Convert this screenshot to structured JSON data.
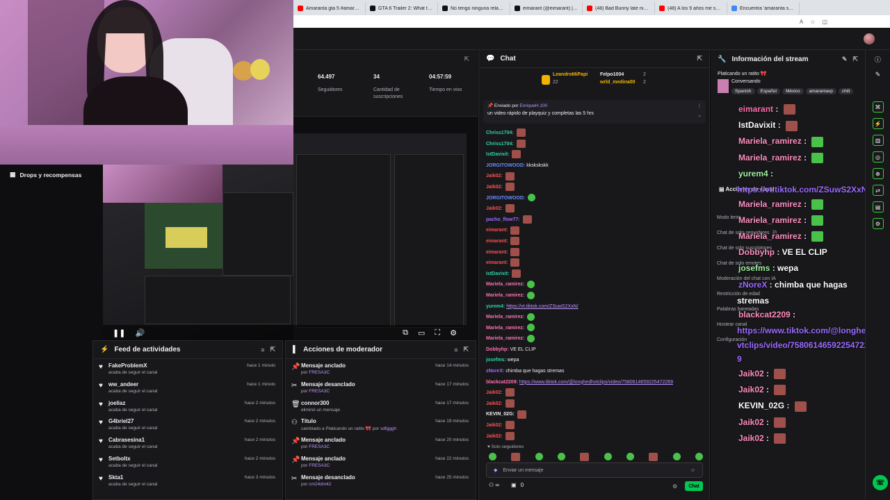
{
  "browser": {
    "tabs": [
      {
        "title": "Amaranta gta 5 #amaranta #",
        "color": "#ff0000"
      },
      {
        "title": "GTA 6 Trailer 2: What to Exp",
        "color": "#111111"
      },
      {
        "title": "No tengo ninguna relación e",
        "color": "#111111"
      },
      {
        "title": "eimarant (@eimarant) | TikTo",
        "color": "#111111"
      },
      {
        "title": "(48) Bad Bunny late night ce",
        "color": "#ff0000"
      },
      {
        "title": "(48) A los 9 años me secuest",
        "color": "#ff0000"
      },
      {
        "title": "Encuentra 'amaranta stream",
        "color": "#4285f4"
      }
    ]
  },
  "left_sidebar": {
    "drops_label": "Drops y recompensas"
  },
  "stats": {
    "followers_value": "64.497",
    "followers_label": "Seguidores",
    "subs_value": "34",
    "subs_label": "Cantidad de suscripciones",
    "live_value": "04:57:59",
    "live_label": "Tiempo en vivo"
  },
  "feed": {
    "title": "Feed de actividades",
    "items": [
      {
        "name": "FakeProblemX",
        "sub": "acaba de seguir el canal",
        "time": "hace 1 minuto"
      },
      {
        "name": "ww_andeer",
        "sub": "acaba de seguir el canal",
        "time": "hace 1 minuto"
      },
      {
        "name": "joeliaz",
        "sub": "acaba de seguir el canal",
        "time": "hace 2 minutos"
      },
      {
        "name": "G4briel27",
        "sub": "acaba de seguir el canal",
        "time": "hace 2 minutos"
      },
      {
        "name": "Cabrasesina1",
        "sub": "acaba de seguir el canal",
        "time": "hace 2 minutos"
      },
      {
        "name": "Setboltx",
        "sub": "acaba de seguir el canal",
        "time": "hace 2 minutos"
      },
      {
        "name": "Skta1",
        "sub": "acaba de seguir el canal",
        "time": "hace 3 minutos"
      }
    ]
  },
  "mod": {
    "title": "Acciones de moderador",
    "items": [
      {
        "icon": "pin",
        "name": "Mensaje anclado",
        "by": "por",
        "user": "FRESA3C",
        "time": "hace 14 minutos"
      },
      {
        "icon": "unpin",
        "name": "Mensaje desanclado",
        "by": "por",
        "user": "FRESA3C",
        "time": "hace 17 minutos"
      },
      {
        "icon": "trash",
        "name": "connor300",
        "by": "eliminó un mensaje",
        "user": "",
        "time": "hace 17 minutos"
      },
      {
        "icon": "title",
        "name": "Título",
        "by": "cambiado a Platicando un ratito 🎀 por",
        "user": "sdfgggh",
        "time": "hace 19 minutos"
      },
      {
        "icon": "pin",
        "name": "Mensaje anclado",
        "by": "por",
        "user": "FRESA3C",
        "time": "hace 20 minutos"
      },
      {
        "icon": "pin",
        "name": "Mensaje anclado",
        "by": "por",
        "user": "FRESA3C",
        "time": "hace 22 minutos"
      },
      {
        "icon": "unpin",
        "name": "Mensaje desanclado",
        "by": "por",
        "user": "cm24dm42",
        "time": "hace 25 minutos"
      }
    ]
  },
  "chat": {
    "title": "Chat",
    "leaders": [
      {
        "name": "LeandroMiPapi",
        "count": "22"
      },
      {
        "name": "Felpo1004",
        "count": "2"
      },
      {
        "name": "wrld_medina00",
        "count": "2"
      }
    ],
    "pinned_by_label": "Enviado por",
    "pinned_by_user": "EnriqueH.100",
    "pinned_text": "un video rápido de playquiz y completas las 5 hrs",
    "messages": [
      {
        "user": "Chriss1704:",
        "color": "#2dd3a8",
        "text": "",
        "emote": "r"
      },
      {
        "user": "Chriss1704:",
        "color": "#2dd3a8",
        "text": "",
        "emote": "r"
      },
      {
        "user": "IstDavixit:",
        "color": "#2dd3a8",
        "text": "",
        "emote": "r"
      },
      {
        "user": "JORGITOWOOD:",
        "color": "#6a8cff",
        "text": "kkskskskk",
        "emote": ""
      },
      {
        "user": "Jaik02:",
        "color": "#ff4f4f",
        "text": "",
        "emote": "r"
      },
      {
        "user": "Jaik02:",
        "color": "#ff4f4f",
        "text": "",
        "emote": "r"
      },
      {
        "user": "JORGITOWOOD:",
        "color": "#6a8cff",
        "text": "",
        "emote": "g"
      },
      {
        "user": "Jaik02:",
        "color": "#ff4f4f",
        "text": "",
        "emote": "r"
      },
      {
        "user": "pacho_flow77:",
        "color": "#9b6bff",
        "text": "",
        "emote": "r"
      },
      {
        "user": "eimarant:",
        "color": "#ff4f4f",
        "text": "",
        "emote": "r"
      },
      {
        "user": "eimarant:",
        "color": "#ff4f4f",
        "text": "",
        "emote": "r"
      },
      {
        "user": "eimarant:",
        "color": "#ff4f4f",
        "text": "",
        "emote": "r"
      },
      {
        "user": "eimarant:",
        "color": "#ff4f4f",
        "text": "",
        "emote": "r"
      },
      {
        "user": "IstDavixit:",
        "color": "#2dd3a8",
        "text": "",
        "emote": "r"
      },
      {
        "user": "Mariela_ramirez:",
        "color": "#ff6fb0",
        "text": "",
        "emote": "g"
      },
      {
        "user": "Mariela_ramirez:",
        "color": "#ff6fb0",
        "text": "",
        "emote": "g"
      },
      {
        "user": "yurem4:",
        "color": "#2dd3a8",
        "text": "",
        "link": "https://vt.tiktok.com/ZSuwS2XxN/",
        "emote": ""
      },
      {
        "user": "Mariela_ramirez:",
        "color": "#ff6fb0",
        "text": "",
        "emote": "g"
      },
      {
        "user": "Mariela_ramirez:",
        "color": "#ff6fb0",
        "text": "",
        "emote": "g"
      },
      {
        "user": "Mariela_ramirez:",
        "color": "#ff6fb0",
        "text": "",
        "emote": "g"
      },
      {
        "user": "Dobbyhp:",
        "color": "#ff6fb0",
        "text": "VE EL CLIP",
        "emote": ""
      },
      {
        "user": "josefms:",
        "color": "#2dd3a8",
        "text": "wepa",
        "emote": ""
      },
      {
        "user": "zNoreX:",
        "color": "#9b6bff",
        "text": "chimba que hagas stremas",
        "emote": ""
      },
      {
        "user": "blackcat2209:",
        "color": "#ff6fb0",
        "text": "",
        "link": "https://www.tiktok.com/@longhedhvtclips/video/7580614659225472269",
        "emote": ""
      },
      {
        "user": "Jaik02:",
        "color": "#ff4f4f",
        "text": "",
        "emote": "r"
      },
      {
        "user": "Jaik02:",
        "color": "#ff4f4f",
        "text": "",
        "emote": "r"
      },
      {
        "user": "KEVIN_02G:",
        "color": "#efeff1",
        "text": "",
        "emote": "r"
      },
      {
        "user": "Jaik02:",
        "color": "#ff4f4f",
        "text": "",
        "emote": "r"
      },
      {
        "user": "Jaik02:",
        "color": "#ff4f4f",
        "text": "",
        "emote": "r"
      }
    ],
    "followers_only": "Solo seguidores",
    "input_placeholder": "Enviar un mensaje",
    "points": "0",
    "send_label": "Chat"
  },
  "info": {
    "title": "Información del stream",
    "stream_title": "Platicando un ratito 🎀",
    "category": "Conversando",
    "tags": [
      "Spanish",
      "Español",
      "México",
      "amarantavp",
      "chill"
    ],
    "actions_title": "Acciones de canal",
    "actions": [
      "Modo lento",
      "Chat de solo seguidores",
      "Chat de solo suscriptores",
      "Chat de solo emotes",
      "Moderación del chat con IA",
      "Restricción de edad",
      "Palabras baneadas",
      "Hostear canal",
      "Configuración"
    ],
    "followers_only_duration": "1h"
  },
  "overlay": {
    "lines": [
      {
        "user": "eimarant",
        "color": "#ff6fb0",
        "text": "",
        "emote": "r"
      },
      {
        "user": "IstDavixit",
        "color": "#ffffff",
        "text": "",
        "emote": "r"
      },
      {
        "user": "Mariela_ramirez",
        "color": "#ff8fc0",
        "text": "",
        "emote": "g"
      },
      {
        "user": "Mariela_ramirez",
        "color": "#ff8fc0",
        "text": "",
        "emote": "g"
      },
      {
        "user": "yurem4",
        "color": "#9ef0a0",
        "text": "",
        "emote": ""
      },
      {
        "user": "",
        "color": "#9b6bff",
        "text": "https://vt.tiktok.com/ZSuwS2XxN/",
        "emote": ""
      },
      {
        "user": "Mariela_ramirez",
        "color": "#ff8fc0",
        "text": "",
        "emote": "g"
      },
      {
        "user": "Mariela_ramirez",
        "color": "#ff8fc0",
        "text": "",
        "emote": "g"
      },
      {
        "user": "Mariela_ramirez",
        "color": "#ff8fc0",
        "text": "",
        "emote": "g"
      },
      {
        "user": "Dobbyhp",
        "color": "#ff8fc0",
        "text": "VE EL CLIP",
        "emote": ""
      },
      {
        "user": "josefms",
        "color": "#9ef0a0",
        "text": "wepa",
        "emote": ""
      },
      {
        "user": "zNoreX",
        "color": "#9b6bff",
        "text": "chimba que hagas",
        "emote": ""
      },
      {
        "user": "",
        "color": "#ffffff",
        "text": "stremas",
        "emote": ""
      },
      {
        "user": "blackcat2209",
        "color": "#ff8fc0",
        "text": "",
        "emote": ""
      },
      {
        "user": "",
        "color": "#9b6bff",
        "text": "https://www.tiktok.com/@longhedh",
        "emote": ""
      },
      {
        "user": "",
        "color": "#9b6bff",
        "text": "vtclips/video/758061465922547226",
        "emote": ""
      },
      {
        "user": "",
        "color": "#9b6bff",
        "text": "9",
        "emote": ""
      },
      {
        "user": "Jaik02",
        "color": "#ff8fc0",
        "text": "",
        "emote": "r"
      },
      {
        "user": "Jaik02",
        "color": "#ff8fc0",
        "text": "",
        "emote": "r"
      },
      {
        "user": "KEVIN_02G",
        "color": "#ffffff",
        "text": "",
        "emote": "r"
      },
      {
        "user": "Jaik02",
        "color": "#ff8fc0",
        "text": "",
        "emote": "r"
      },
      {
        "user": "Jaik02",
        "color": "#ff8fc0",
        "text": "",
        "emote": "r"
      }
    ]
  },
  "colors": {
    "accent": "#00c853",
    "link": "#bf94ff",
    "panel": "#18181b"
  }
}
